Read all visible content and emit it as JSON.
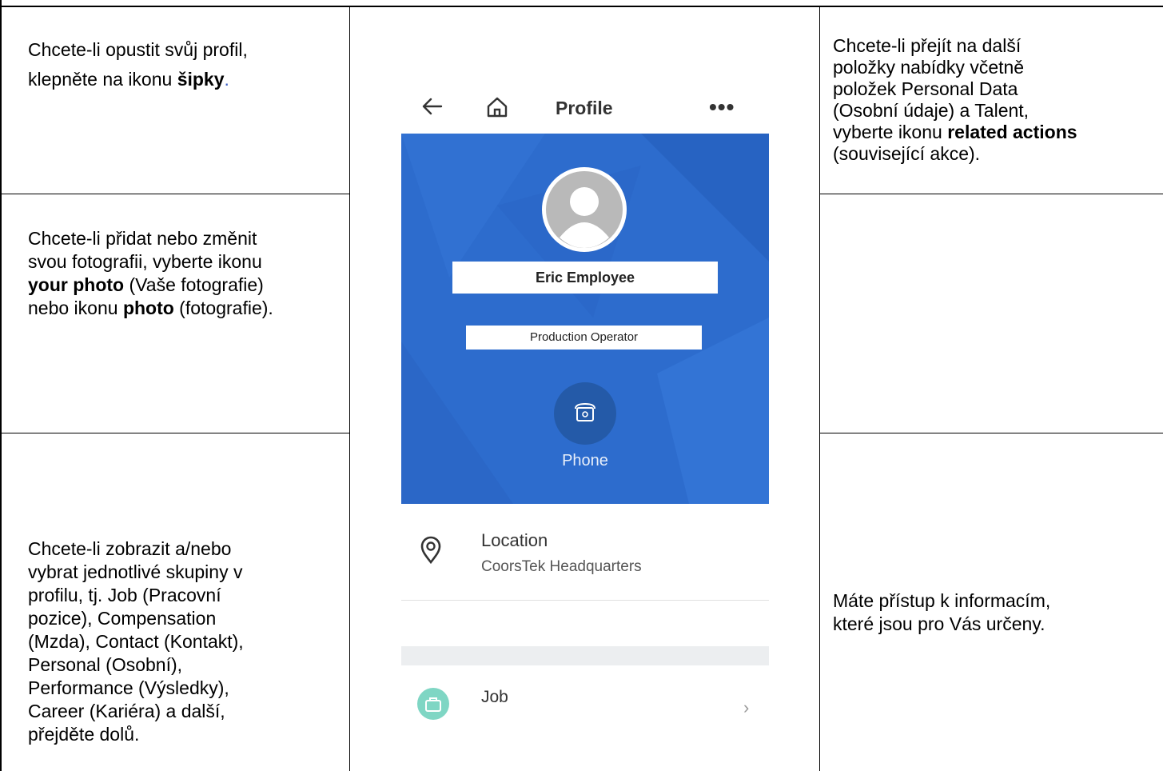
{
  "left": {
    "cell1": {
      "text": "Chcete-li opustit svůj profil,",
      "line2": "klepněte na ikonu ",
      "bold": "šipky",
      "end": "."
    },
    "cell2": {
      "l1": "Chcete-li přidat nebo změnit",
      "l2": "svou fotografii, vyberte ikonu",
      "b1": "your photo",
      "t1": " (Vaše fotografie)",
      "t2": "nebo ikonu ",
      "b2": "photo",
      "t3": " (fotografie)."
    },
    "cell3": {
      "lines": [
        "Chcete-li zobrazit a/nebo",
        "vybrat jednotlivé skupiny v",
        "profilu, tj. Job (Pracovní",
        "pozice), Compensation",
        "(Mzda), Contact (Kontakt),",
        "Personal (Osobní),",
        "Performance (Výsledky),",
        "Career (Kariéra) a další,",
        "přejděte dolů."
      ]
    }
  },
  "right": {
    "cell1": {
      "lines": [
        "Chcete-li přejít na další",
        "položky nabídky včetně",
        "položek Personal Data",
        "(Osobní údaje) a Talent,"
      ],
      "l5a": "vyberte ikonu ",
      "l5b": "related actions",
      "l6": "(související akce)."
    },
    "cell3": {
      "lines": [
        "Máte přístup k informacím,",
        "které jsou pro Vás určeny."
      ]
    }
  },
  "phone": {
    "title": "Profile",
    "more": "•••",
    "name": "Eric Employee",
    "position": "Production Operator",
    "phone_label": "Phone",
    "location_title": "Location",
    "location_value": "CoorsTek Headquarters",
    "job_label": "Job",
    "chevron": "›",
    "colors": {
      "hero": "#2d6ccd",
      "phone_button": "#245aa8",
      "job_icon": "#7fd6c4"
    },
    "icons": [
      "back-arrow-icon",
      "home-icon",
      "more-icon",
      "avatar-icon",
      "telephone-icon",
      "location-pin-icon",
      "briefcase-icon",
      "chevron-right-icon"
    ]
  }
}
